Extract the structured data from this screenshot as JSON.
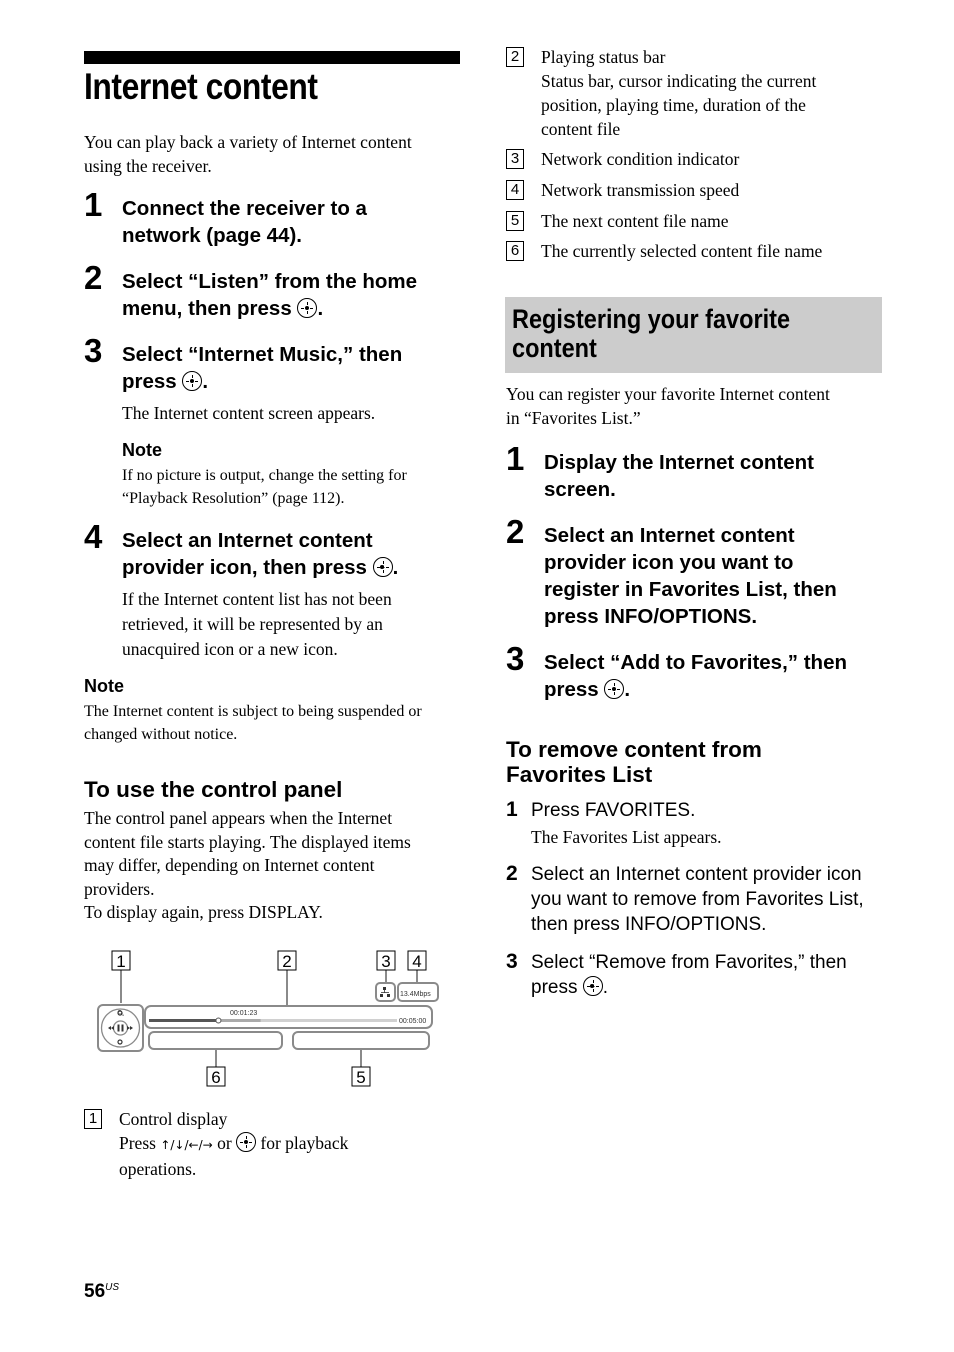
{
  "left": {
    "title": "Internet content",
    "intro": [
      "You can play back a variety of Internet content",
      "using the receiver."
    ],
    "steps": [
      {
        "num": "1",
        "lines": [
          "Connect the receiver to a",
          "network (page 44)."
        ]
      },
      {
        "num": "2",
        "lines": [
          "Select “Listen” from the home",
          "menu, then press"
        ]
      },
      {
        "num": "3",
        "lines": [
          "Select “Internet Music,” then",
          "press"
        ],
        "body": "The Internet content screen appears.",
        "note_head": "Note",
        "note_lines": [
          "If no picture is output, change the setting for",
          "“Playback Resolution” (page 112)."
        ]
      },
      {
        "num": "4",
        "lines": [
          "Select an Internet content",
          "provider icon, then press"
        ],
        "body_lines": [
          "If the Internet content list has not been",
          "retrieved, it will be represented by an",
          "unacquired icon or a new icon."
        ]
      }
    ],
    "note": {
      "head": "Note",
      "lines": [
        "The Internet content is subject to being suspended or",
        "changed without notice."
      ]
    },
    "control_panel": {
      "heading": "To use the control panel",
      "lines": [
        "The control panel appears when the Internet",
        "content file starts playing. The displayed items",
        "may differ, depending on Internet content",
        "providers.",
        "To display again, press DISPLAY."
      ]
    },
    "diagram": {
      "callouts": [
        "1",
        "2",
        "3",
        "4",
        "5",
        "6"
      ],
      "elapsed_time": "00:01:23",
      "duration": "00:05:00",
      "speed": "13.4Mbps",
      "progress_fraction": 0.28,
      "buffer_fraction": 0.45,
      "colors": {
        "stroke": "#8a8a8a",
        "played": "#555555",
        "buffer": "#aaaaaa",
        "track": "#d0d0d0"
      }
    },
    "legend1": {
      "num": "1",
      "title": "Control display",
      "press": "Press",
      "arrows": "↑/↓/←/→",
      "or": "or",
      "suffix": "for playback",
      "line3": "operations."
    }
  },
  "right": {
    "legend": [
      {
        "num": "2",
        "lines": [
          "Playing status bar",
          "Status bar, cursor indicating the current",
          "position, playing time, duration of the",
          "content file"
        ]
      },
      {
        "num": "3",
        "lines": [
          "Network condition indicator"
        ]
      },
      {
        "num": "4",
        "lines": [
          "Network transmission speed"
        ]
      },
      {
        "num": "5",
        "lines": [
          "The next content file name"
        ]
      },
      {
        "num": "6",
        "lines": [
          "The currently selected content file name"
        ]
      }
    ],
    "section_title": [
      "Registering your favorite",
      "content"
    ],
    "section_intro": [
      "You can register your favorite Internet content",
      "in “Favorites List.”"
    ],
    "steps": [
      {
        "num": "1",
        "lines": [
          "Display the Internet content",
          "screen."
        ]
      },
      {
        "num": "2",
        "lines": [
          "Select an Internet content",
          "provider icon you want to",
          "register in Favorites List, then",
          "press INFO/OPTIONS."
        ]
      },
      {
        "num": "3",
        "lines": [
          "Select “Add to Favorites,” then",
          "press"
        ]
      }
    ],
    "remove": {
      "heading": [
        "To remove content from",
        "Favorites List"
      ],
      "steps": [
        {
          "num": "1",
          "lines": [
            "Press FAVORITES."
          ],
          "body": "The Favorites List appears."
        },
        {
          "num": "2",
          "lines": [
            "Select an Internet content provider icon",
            "you want to remove from Favorites List,",
            "then press INFO/OPTIONS."
          ]
        },
        {
          "num": "3",
          "lines": [
            "Select “Remove from Favorites,” then",
            "press"
          ]
        }
      ]
    }
  },
  "footer": {
    "page": "56",
    "suffix": "US"
  }
}
